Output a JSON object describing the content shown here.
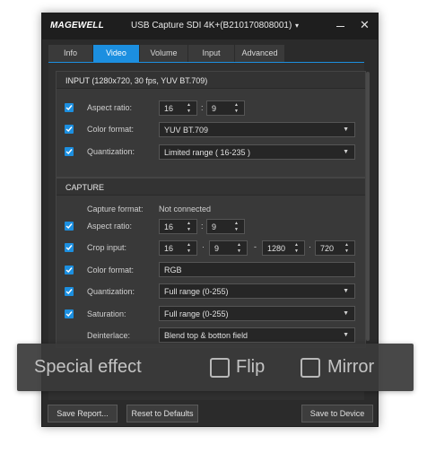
{
  "titlebar": {
    "brand": "MAGEWELL",
    "title": "USB Capture SDI 4K+(B210170808001)",
    "caret": "▾",
    "close": "✕"
  },
  "tabs": [
    {
      "label": "Info",
      "active": false
    },
    {
      "label": "Video",
      "active": true
    },
    {
      "label": "Volume",
      "active": false
    },
    {
      "label": "Input",
      "active": false
    },
    {
      "label": "Advanced",
      "active": false
    }
  ],
  "input": {
    "title": "INPUT (1280x720, 30 fps, YUV BT.709)",
    "aspect_label": "Aspect ratio:",
    "aspect_w": "16",
    "aspect_sep": ":",
    "aspect_h": "9",
    "color_label": "Color format:",
    "color_value": "YUV BT.709",
    "quant_label": "Quantization:",
    "quant_value": "Limited range ( 16-235 )"
  },
  "capture": {
    "title": "CAPTURE",
    "format_label": "Capture format:",
    "format_value": "Not connected",
    "aspect_label": "Aspect ratio:",
    "aspect_w": "16",
    "aspect_sep": ":",
    "aspect_h": "9",
    "crop_label": "Crop input:",
    "crop_a": "16",
    "crop_b": "9",
    "crop_c": "1280",
    "crop_d": "720",
    "crop_sep_dot": "·",
    "crop_sep_dash": "-",
    "color_label": "Color format:",
    "color_value": "RGB",
    "quant_label": "Quantization:",
    "quant_value": "Full range (0-255)",
    "sat_label": "Saturation:",
    "sat_value": "Full range (0-255)",
    "deint_label": "Deinterlace:",
    "deint_value": "Blend top & botton field"
  },
  "overlay": {
    "label": "Special effect",
    "flip": "Flip",
    "mirror": "Mirror"
  },
  "footer": {
    "save_report": "Save Report...",
    "reset": "Reset to Defaults",
    "save_device": "Save to Device"
  },
  "colors": {
    "accent": "#1c8fe0",
    "background": "#2b2b2b"
  }
}
